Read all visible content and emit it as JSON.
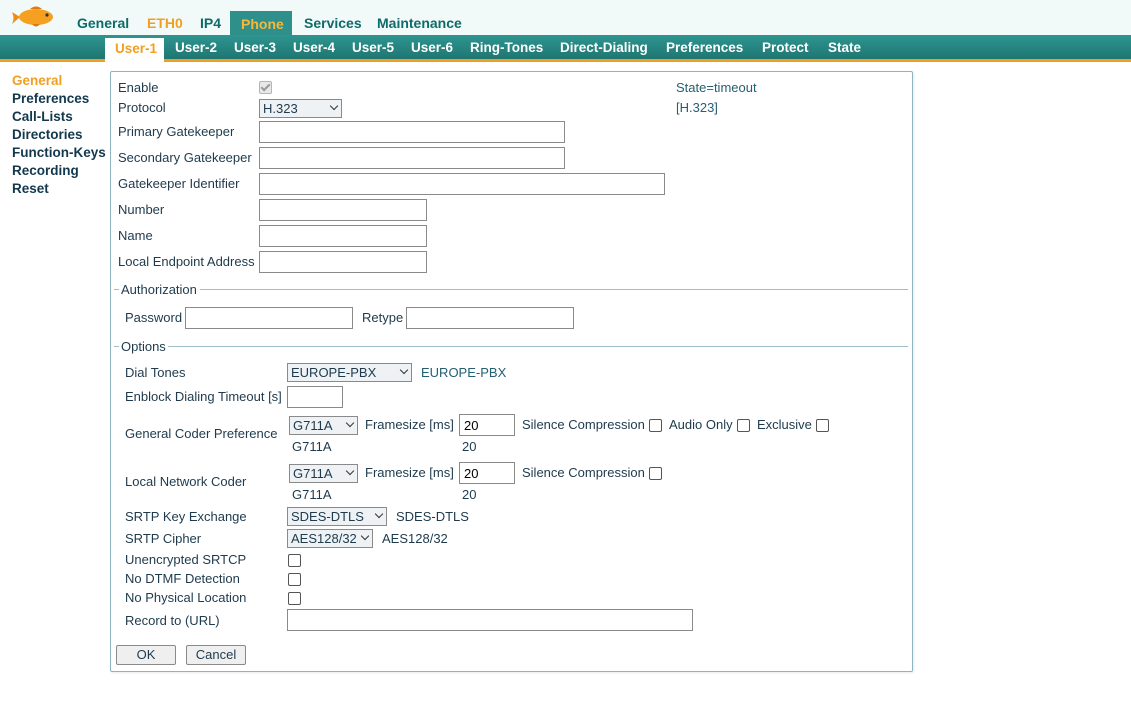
{
  "top_nav": [
    "General",
    "ETH0",
    "IP4",
    "Phone",
    "Services",
    "Maintenance"
  ],
  "sub_nav": [
    "User-1",
    "User-2",
    "User-3",
    "User-4",
    "User-5",
    "User-6",
    "Ring-Tones",
    "Direct-Dialing",
    "Preferences",
    "Protect",
    "State"
  ],
  "left_nav": [
    "General",
    "Preferences",
    "Call-Lists",
    "Directories",
    "Function-Keys",
    "Recording",
    "Reset"
  ],
  "form": {
    "enable_label": "Enable",
    "enable_checked": true,
    "state_text": "State=timeout",
    "protocol_label": "Protocol",
    "protocol_value": "H.323",
    "protocol_current": "[H.323]",
    "primary_gk_label": "Primary Gatekeeper",
    "primary_gk_value": "",
    "secondary_gk_label": "Secondary Gatekeeper",
    "secondary_gk_value": "",
    "gk_identifier_label": "Gatekeeper Identifier",
    "gk_identifier_value": "",
    "number_label": "Number",
    "number_value": "",
    "name_label": "Name",
    "name_value": "",
    "local_endpoint_label": "Local Endpoint Address",
    "local_endpoint_value": ""
  },
  "authorization": {
    "legend": "Authorization",
    "password_label": "Password",
    "retype_label": "Retype"
  },
  "options": {
    "legend": "Options",
    "dial_tones_label": "Dial Tones",
    "dial_tones_value": "EUROPE-PBX",
    "dial_tones_current": "EUROPE-PBX",
    "enblock_label": "Enblock Dialing Timeout [s]",
    "enblock_value": "",
    "general_coder_label": "General Coder Preference",
    "general_coder_value": "G711A",
    "general_coder_current": "G711A",
    "framesize_label": "Framesize [ms]",
    "general_framesize_value": "20",
    "general_framesize_current": "20",
    "silence_label": "Silence Compression",
    "audio_only_label": "Audio Only",
    "exclusive_label": "Exclusive",
    "local_coder_label": "Local Network Coder",
    "local_coder_value": "G711A",
    "local_coder_current": "G711A",
    "local_framesize_value": "20",
    "local_framesize_current": "20",
    "srtp_kx_label": "SRTP Key Exchange",
    "srtp_kx_value": "SDES-DTLS",
    "srtp_kx_current": "SDES-DTLS",
    "srtp_cipher_label": "SRTP Cipher",
    "srtp_cipher_value": "AES128/32",
    "srtp_cipher_current": "AES128/32",
    "unencrypted_srtcp_label": "Unencrypted SRTCP",
    "no_dtmf_label": "No DTMF Detection",
    "no_location_label": "No Physical Location",
    "record_to_label": "Record to (URL)",
    "record_to_value": ""
  },
  "buttons": {
    "ok": "OK",
    "cancel": "Cancel"
  },
  "colors": {
    "teal": "#2e8f8b",
    "orange": "#f0a020",
    "navy": "#13384d"
  },
  "icons": {
    "logo": "goldfish-logo-icon"
  }
}
